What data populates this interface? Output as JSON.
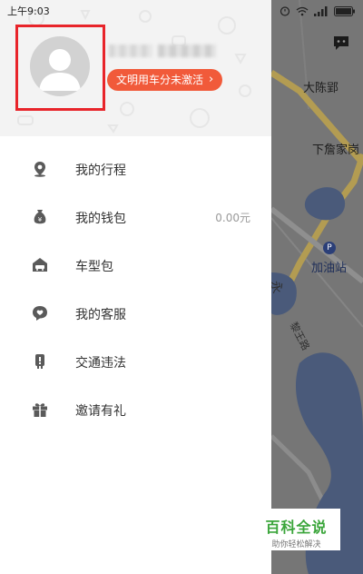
{
  "status_bar": {
    "time": "上午9:03",
    "icons": [
      "alarm-icon",
      "wifi-icon",
      "signal-icon",
      "battery-icon"
    ]
  },
  "map": {
    "labels": [
      "大陈郢",
      "下詹家岗",
      "加油站"
    ],
    "road_labels": [
      "永",
      "黎王路"
    ],
    "gas_icon_glyph": "P",
    "colors": {
      "water": "#4a5a7a",
      "road": "#bfa65a",
      "land": "#767676"
    }
  },
  "drawer": {
    "profile": {
      "username": "",
      "badge_label": "文明用车分未激活",
      "badge_chevron": "›",
      "badge_color": "#f15a3a",
      "highlight_color": "#e8242a"
    },
    "menu": [
      {
        "label": "我的行程",
        "icon": "location-pin-icon",
        "value": ""
      },
      {
        "label": "我的钱包",
        "icon": "wallet-icon",
        "value": "0.00元"
      },
      {
        "label": "车型包",
        "icon": "car-package-icon",
        "value": ""
      },
      {
        "label": "我的客服",
        "icon": "customer-service-icon",
        "value": ""
      },
      {
        "label": "交通违法",
        "icon": "traffic-violation-icon",
        "value": ""
      },
      {
        "label": "邀请有礼",
        "icon": "gift-icon",
        "value": ""
      }
    ]
  },
  "watermark": {
    "title": "百科全说",
    "subtitle": "助你轻松解决",
    "color": "#3aa53a"
  }
}
